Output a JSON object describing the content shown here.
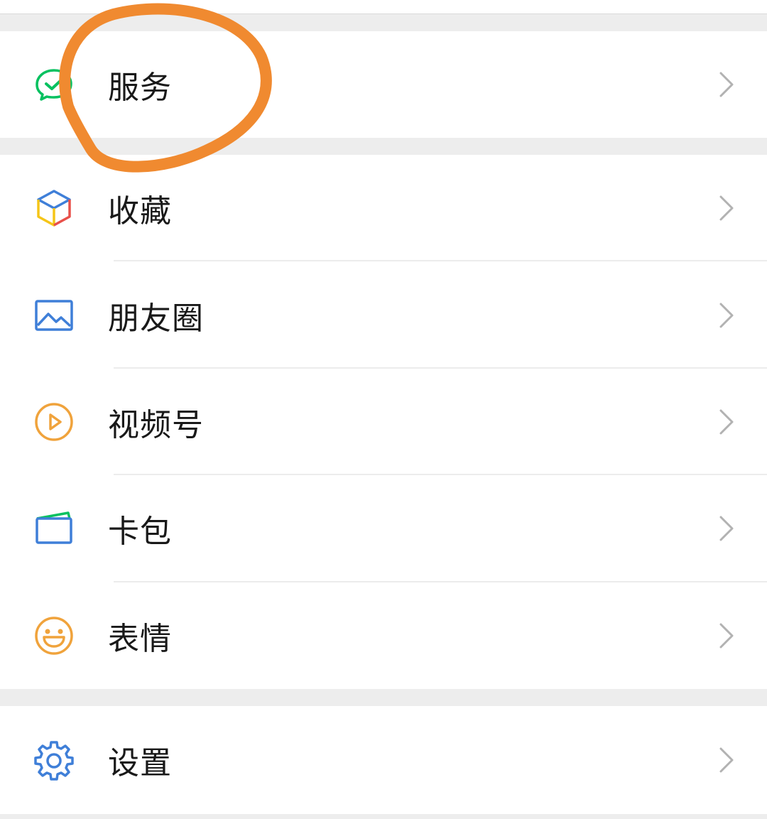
{
  "menu": {
    "services": {
      "label": "服务",
      "icon": "wechat-pay-icon"
    },
    "items": [
      {
        "label": "收藏",
        "icon": "cube-icon"
      },
      {
        "label": "朋友圈",
        "icon": "picture-icon"
      },
      {
        "label": "视频号",
        "icon": "play-circle-icon"
      },
      {
        "label": "卡包",
        "icon": "card-wallet-icon"
      },
      {
        "label": "表情",
        "icon": "smiley-icon"
      }
    ],
    "settings": {
      "label": "设置",
      "icon": "gear-icon"
    }
  },
  "colors": {
    "background": "#ededed",
    "row": "#ffffff",
    "text": "#191919",
    "chevron": "#b2b2b2",
    "highlight": "#f08a30",
    "wechat_green": "#07c160",
    "blue": "#3f7fd8",
    "orange": "#f0a33c"
  }
}
